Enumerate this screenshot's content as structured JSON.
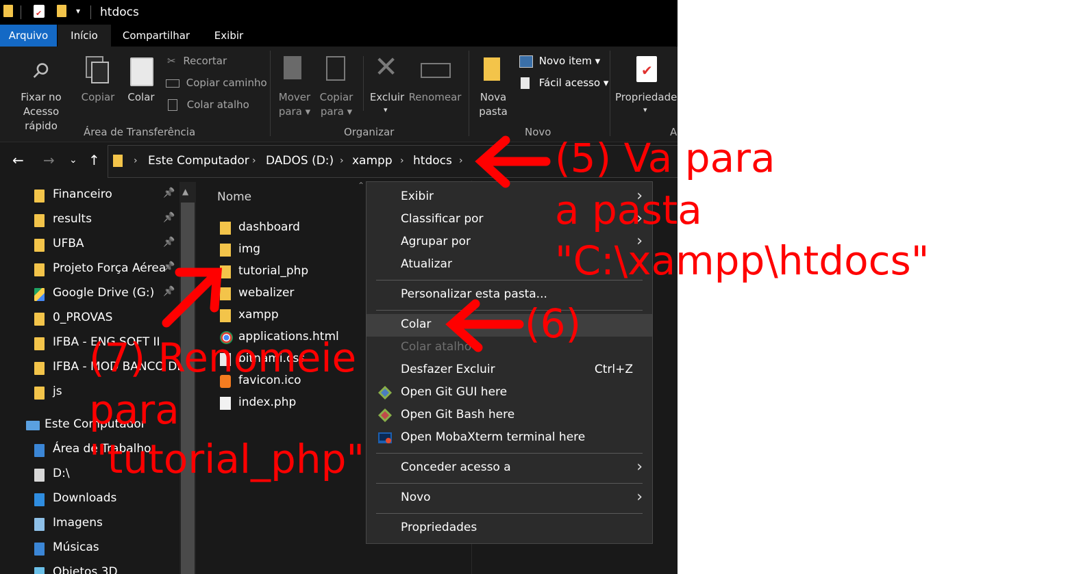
{
  "window": {
    "title": "htdocs"
  },
  "tabs": [
    "Arquivo",
    "Início",
    "Compartilhar",
    "Exibir"
  ],
  "ribbon": {
    "pin_line1": "Fixar no",
    "pin_line2": "Acesso rápido",
    "copy": "Copiar",
    "paste": "Colar",
    "cut": "Recortar",
    "copy_path": "Copiar caminho",
    "paste_shortcut": "Colar atalho",
    "group_clipboard": "Área de Transferência",
    "move_line1": "Mover",
    "move_line2": "para ▾",
    "copyto_line1": "Copiar",
    "copyto_line2": "para ▾",
    "delete": "Excluir",
    "rename": "Renomear",
    "group_organize": "Organizar",
    "newfolder_line1": "Nova",
    "newfolder_line2": "pasta",
    "new_item": "Novo item ▾",
    "easy_access": "Fácil acesso ▾",
    "group_new": "Novo",
    "properties": "Propriedades",
    "group_open": "Al"
  },
  "breadcrumb": [
    "Este Computador",
    "DADOS (D:)",
    "xampp",
    "htdocs"
  ],
  "sidebar": [
    {
      "label": "Financeiro",
      "pinned": true
    },
    {
      "label": "results",
      "pinned": true
    },
    {
      "label": "UFBA",
      "pinned": true
    },
    {
      "label": "Projeto Força Aérea",
      "pinned": true
    },
    {
      "label": "Google Drive (G:)",
      "pinned": true
    },
    {
      "label": "0_PROVAS",
      "pinned": false
    },
    {
      "label": "IFBA - ENG SOFT II",
      "pinned": false
    },
    {
      "label": "IFBA - MOD BANCO DE",
      "pinned": false
    },
    {
      "label": "js",
      "pinned": false
    },
    {
      "label": "Este Computador",
      "pinned": false
    },
    {
      "label": "Área de Trabalho",
      "pinned": false
    },
    {
      "label": "D:\\",
      "pinned": false
    },
    {
      "label": "Downloads",
      "pinned": false
    },
    {
      "label": "Imagens",
      "pinned": false
    },
    {
      "label": "Músicas",
      "pinned": false
    },
    {
      "label": "Objetos 3D",
      "pinned": false
    }
  ],
  "files": {
    "column_name": "Nome",
    "items": [
      "dashboard",
      "img",
      "tutorial_php",
      "webalizer",
      "xampp",
      "applications.html",
      "bitnami.css",
      "favicon.ico",
      "index.php"
    ]
  },
  "context_menu": {
    "items": [
      "Exibir",
      "Classificar por",
      "Agrupar por",
      "Atualizar",
      "Personalizar esta pasta...",
      "Colar",
      "Colar atalho",
      "Desfazer Excluir",
      "Open Git GUI here",
      "Open Git Bash here",
      "Open MobaXterm terminal here",
      "Conceder acesso a",
      "Novo",
      "Propriedades"
    ],
    "undo_shortcut": "Ctrl+Z"
  },
  "annotations": {
    "step5_line1": "(5) Va para",
    "step5_line2": "a pasta",
    "step5_line3": "\"C:\\xampp\\htdocs\"",
    "step6": "(6)",
    "step7_line1": "(7) Renomeie",
    "step7_line2": "para",
    "step7_line3": "\"tutorial_php\""
  },
  "colors": {
    "accent": "#1469c5",
    "annotation": "#ff0000",
    "folder": "#f3c44a"
  }
}
